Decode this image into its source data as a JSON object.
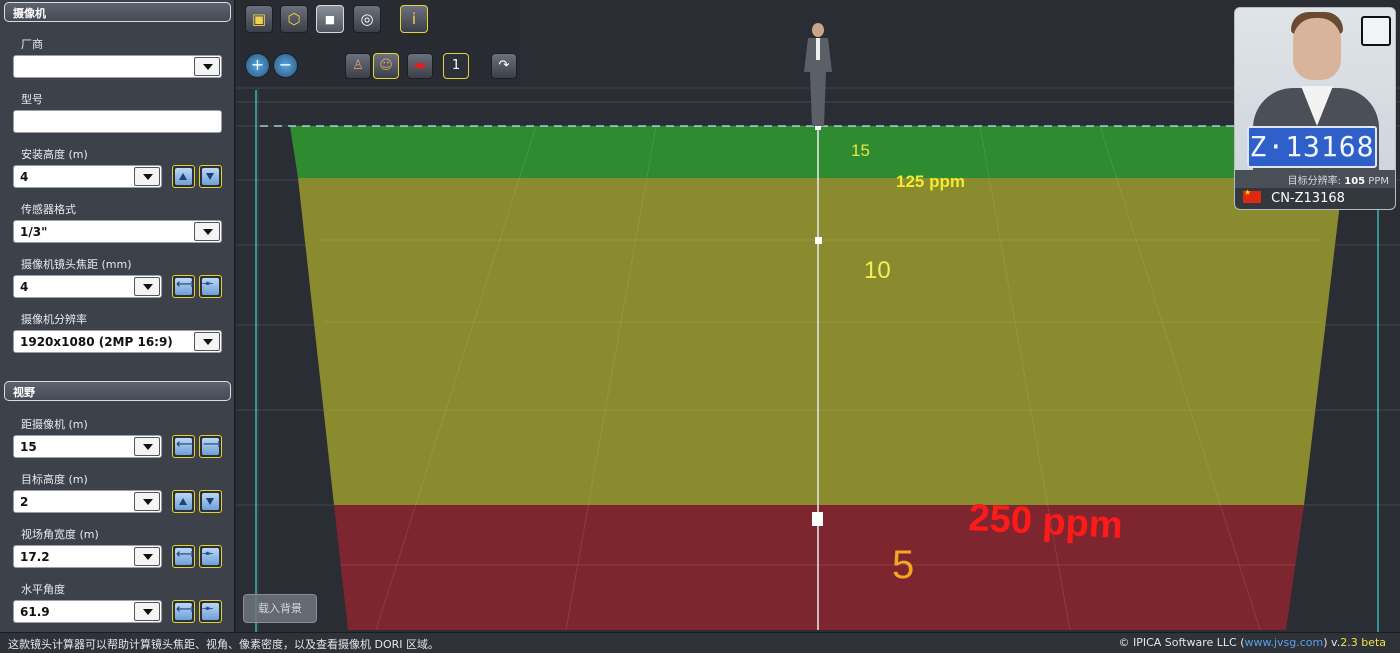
{
  "camera_section": {
    "title": "摄像机",
    "manufacturer": {
      "label": "厂商",
      "value": ""
    },
    "model": {
      "label": "型号",
      "value": ""
    },
    "mount_height": {
      "label": "安装高度 (m)",
      "value": "4"
    },
    "sensor_format": {
      "label": "传感器格式",
      "value": "1/3\""
    },
    "focal_length": {
      "label": "摄像机镜头焦距 (mm)",
      "value": "4"
    },
    "resolution": {
      "label": "摄像机分辨率",
      "value": "1920x1080 (2MP 16:9)"
    }
  },
  "fov_section": {
    "title": "视野",
    "distance": {
      "label": "距摄像机 (m)",
      "value": "15"
    },
    "target_height": {
      "label": "目标高度 (m)",
      "value": "2"
    },
    "fov_width": {
      "label": "视场角宽度 (m)",
      "value": "17.2"
    },
    "horizontal_angle": {
      "label": "水平角度",
      "value": "61.9"
    }
  },
  "scene": {
    "zones": [
      {
        "distance_label": "15",
        "color": "#2e8b30"
      },
      {
        "distance_label": "10",
        "color": "#8a8a2e"
      },
      {
        "distance_label": "5",
        "color": "#7d2630"
      }
    ],
    "ppm_labels": [
      "125 ppm",
      "250 ppm"
    ],
    "colors": {
      "green_zone": "#2e8b30",
      "yellow_zone": "#8a8a2e",
      "red_zone": "#7d2630",
      "ppm_far": "#f1ea30",
      "ppm_near": "#ff1a1a",
      "near_label": "#f5a623"
    }
  },
  "toolbar": {
    "row1_icons": [
      "cube-icon",
      "cube-outline-icon",
      "camera-icon",
      "fov-cone-icon",
      "info-icon"
    ],
    "row2_icons": [
      "zoom-in-icon",
      "zoom-out-icon",
      "person-icon",
      "person-face-icon",
      "car-icon",
      "grid-1-icon",
      "share-icon"
    ]
  },
  "load_background_label": "载入背景",
  "preview": {
    "plate_text": "Z·13168",
    "resolution_label": "目标分辨率:",
    "resolution_value": "105",
    "resolution_unit": "PPM",
    "plate_caption": "CN-Z13168"
  },
  "footer": {
    "description": "这款镜头计算器可以帮助计算镜头焦距、视角、像素密度，以及查看摄像机 DORI 区域。",
    "copyright": "© IPICA Software LLC (",
    "link": "www.jvsg.com",
    "copyright_end": ") v.",
    "version": "2.3 beta"
  }
}
